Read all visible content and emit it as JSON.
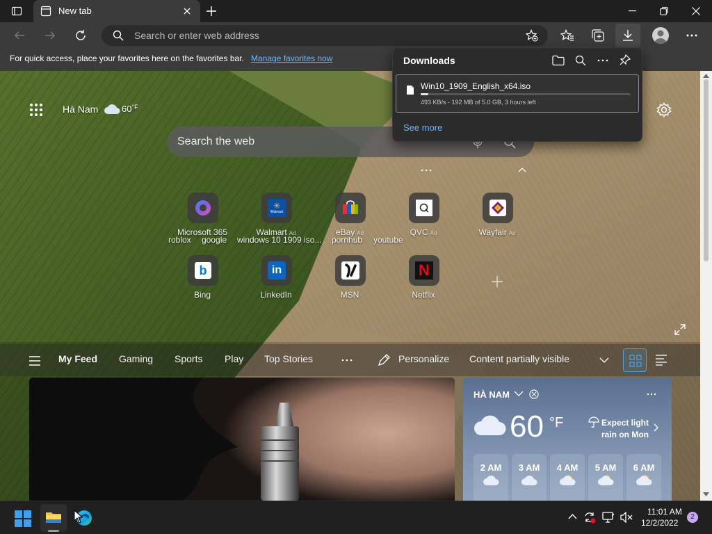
{
  "tab": {
    "title": "New tab"
  },
  "address": {
    "placeholder": "Search or enter web address"
  },
  "favbar": {
    "text": "For quick access, place your favorites here on the favorites bar.",
    "link": "Manage favorites now"
  },
  "downloads": {
    "title": "Downloads",
    "file_name": "Win10_1909_English_x64.iso",
    "status": "493 KB/s - 192 MB of 5.0 GB, 3 hours left",
    "progress": 0.038,
    "see_more": "See more"
  },
  "header": {
    "location": "Hà Nam",
    "temp": "60",
    "unit": "°F"
  },
  "search": {
    "placeholder": "Search the web"
  },
  "trending": [
    "roblox",
    "google",
    "windows 10 1909 iso...",
    "pornhub",
    "youtube"
  ],
  "sites": [
    {
      "label": "Microsoft 365",
      "ad": ""
    },
    {
      "label": "Walmart",
      "ad": "Ad"
    },
    {
      "label": "eBay",
      "ad": "Ad"
    },
    {
      "label": "QVC",
      "ad": "Ad"
    },
    {
      "label": "Wayfair",
      "ad": "Ad"
    },
    {
      "label": "Bing",
      "ad": ""
    },
    {
      "label": "LinkedIn",
      "ad": ""
    },
    {
      "label": "MSN",
      "ad": ""
    },
    {
      "label": "Netflix",
      "ad": ""
    }
  ],
  "tile_text": {
    "walmart": "Walmart",
    "linkedin": "in",
    "netflix": "N",
    "bing": "b"
  },
  "feed": {
    "tabs": [
      "My Feed",
      "Gaming",
      "Sports",
      "Play",
      "Top Stories"
    ],
    "personalize": "Personalize",
    "visibility": "Content partially visible"
  },
  "weather": {
    "location": "HÀ NAM",
    "temp": "60",
    "unit": "°F",
    "forecast": "Expect light rain on Mon",
    "hours": [
      "2 AM",
      "3 AM",
      "4 AM",
      "5 AM",
      "6 AM"
    ]
  },
  "taskbar": {
    "time": "11:01 AM",
    "date": "12/2/2022",
    "badge": "2"
  },
  "colors": {
    "accent": "#4aa0e6",
    "favlink": "#6cb6ff"
  }
}
